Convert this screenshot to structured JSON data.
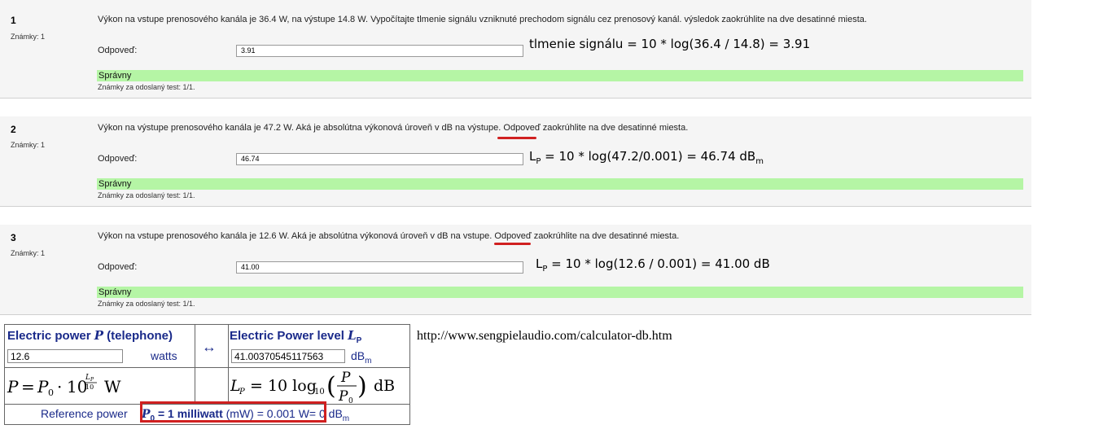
{
  "questions": [
    {
      "number": "1",
      "marks": "Známky: 1",
      "text": "Výkon na vstupe prenosového kanála je 36.4 W, na výstupe 14.8 W. Vypočítajte tlmenie signálu vzniknuté prechodom signálu cez prenosový kanál. výsledok zaokrúhlite na dve desatinné miesta.",
      "answer_label": "Odpoveď:",
      "answer_value": "3.91",
      "result": "Správny",
      "score": "Známky za odoslaný test: 1/1."
    },
    {
      "number": "2",
      "marks": "Známky: 1",
      "text_before": "Výkon na výstupe prenosového kanála je 47.2 W. Aká je absolútna výkonová úroveň v dB na ",
      "text_emph": "výstupe",
      "text_after": ". Odpoveď zaokrúhlite na dve desatinné miesta.",
      "answer_label": "Odpoveď:",
      "answer_value": "46.74",
      "result": "Správny",
      "score": "Známky za odoslaný test: 1/1."
    },
    {
      "number": "3",
      "marks": "Známky: 1",
      "text_before": "Výkon na vstupe prenosového kanála je 12.6 W. Aká je absolútna výkonová úroveň v dB na ",
      "text_emph": "vstupe",
      "text_after": ". Odpoveď zaokrúhlite na dve desatinné miesta.",
      "answer_label": "Odpoveď:",
      "answer_value": "41.00",
      "result": "Správny",
      "score": "Známky za odoslaný test: 1/1."
    }
  ],
  "annotations": {
    "a1": "tlmenie signálu = 10 * log(36.4 / 14.8) = 3.91",
    "a2_pre": "L",
    "a2_sub1": "P",
    "a2_mid": " = 10 * log(47.2/0.001) = 46.74 dB",
    "a2_sub2": "m",
    "a3_pre": "L",
    "a3_sub": "P",
    "a3_rest": " = 10 * log(12.6 / 0.001) = 41.00 dB"
  },
  "calculator": {
    "left_header": "Electric power ",
    "left_header_var": "P",
    "left_header_tail": " (telephone)",
    "left_value": "12.6",
    "left_unit": "watts",
    "arrow": "↔",
    "right_header": "Electric Power level ",
    "right_header_var": "L",
    "right_header_sub": "P",
    "right_value": "41.00370545117563",
    "right_unit": "dB",
    "right_unit_sub": "m",
    "ref_label": "Reference power ",
    "ref_p0": "P",
    "ref_p0_sub": "0",
    "ref_eq": " = 1 milliwatt",
    "ref_rest": " (mW) = 0.001 W",
    "ref_tail": "= 0 dB",
    "ref_tail_sub": "m"
  },
  "url": "http://www.sengpielaudio.com/calculator-db.htm",
  "colors": {
    "correct_bg": "#b5f5a5",
    "underline": "#d02020",
    "calc_blue": "#1a2a8a"
  }
}
